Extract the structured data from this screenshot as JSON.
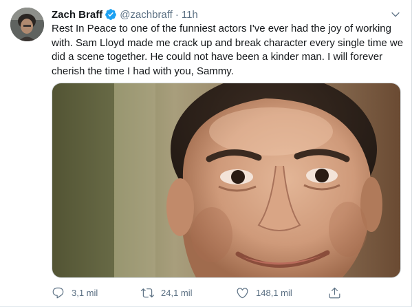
{
  "author": {
    "name": "Zach Braff",
    "handle": "@zachbraff",
    "separator": "·",
    "time": "11h",
    "verified": true,
    "verified_color": "#1da1f2"
  },
  "tweet": {
    "text": "Rest In Peace to one of the funniest actors I've ever had the joy of working\nwith. Sam Lloyd made me crack up and break character every single time we\ndid a scene together. He could not have been a kinder man. I will forever\ncherish the time I had with you, Sammy."
  },
  "actions": {
    "reply": {
      "icon": "reply-icon",
      "count": "3,1 mil"
    },
    "retweet": {
      "icon": "retweet-icon",
      "count": "24,1 mil"
    },
    "like": {
      "icon": "heart-icon",
      "count": "148,1 mil"
    },
    "share": {
      "icon": "share-icon"
    }
  },
  "colors": {
    "text": "#14171a",
    "secondary": "#5b7083",
    "border": "#d7dde1"
  }
}
